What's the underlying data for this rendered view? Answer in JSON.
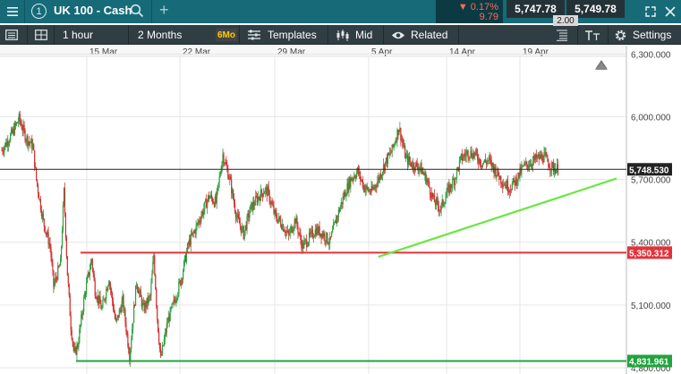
{
  "header": {
    "menu_icon": "hamburger-icon",
    "info_icon_text": "1",
    "symbol": "UK 100 - Cash",
    "search_icon": "search-icon",
    "add_icon": "plus-icon",
    "change_pct": "▼ 0.17%",
    "change_abs": "9.79",
    "sell_price": "5,747.78",
    "buy_price": "5,749.78",
    "spread": "2.00",
    "window_icons": [
      "expand-icon",
      "close-icon"
    ]
  },
  "toolbar": {
    "interval": "1 hour",
    "range": "2 Months",
    "range_badge": "6Mo",
    "templates_label": "Templates",
    "price_type_label": "Mid",
    "related_label": "Related",
    "settings_label": "Settings"
  },
  "chart_data": {
    "type": "candlestick",
    "instrument": "UK 100 - Cash",
    "interval": "1 hour",
    "x_tick_labels": [
      "15 Mar",
      "22 Mar",
      "29 Mar",
      "5 Apr",
      "14 Apr",
      "19 Apr"
    ],
    "y_tick_labels": [
      "6,300.000",
      "6,000.000",
      "5,700.000",
      "5,400.000",
      "5,100.000",
      "4,800.000"
    ],
    "y_ticks": [
      6300,
      6000,
      5700,
      5400,
      5100,
      4800
    ],
    "ylim": [
      4770,
      6340
    ],
    "grid": true,
    "colors": {
      "up": "#2f9e3f",
      "down": "#d3302f",
      "grid": "#e6e6e6"
    },
    "price_path": [
      [
        0,
        5840
      ],
      [
        3,
        5920
      ],
      [
        5,
        5990
      ],
      [
        7,
        5900
      ],
      [
        9,
        5860
      ],
      [
        10,
        5700
      ],
      [
        12,
        5500
      ],
      [
        14,
        5380
      ],
      [
        15,
        5190
      ],
      [
        17,
        5300
      ],
      [
        18,
        5640
      ],
      [
        19,
        5250
      ],
      [
        20,
        5000
      ],
      [
        21,
        4860
      ],
      [
        22,
        4910
      ],
      [
        24,
        5150
      ],
      [
        26,
        5320
      ],
      [
        27,
        5170
      ],
      [
        29,
        5080
      ],
      [
        31,
        5230
      ],
      [
        33,
        5010
      ],
      [
        35,
        5120
      ],
      [
        37,
        4860
      ],
      [
        39,
        5210
      ],
      [
        41,
        5080
      ],
      [
        43,
        5140
      ],
      [
        44,
        5340
      ],
      [
        45,
        5040
      ],
      [
        46,
        4840
      ],
      [
        48,
        5020
      ],
      [
        50,
        5120
      ],
      [
        52,
        5230
      ],
      [
        54,
        5390
      ],
      [
        56,
        5460
      ],
      [
        58,
        5540
      ],
      [
        60,
        5620
      ],
      [
        62,
        5590
      ],
      [
        64,
        5820
      ],
      [
        66,
        5700
      ],
      [
        68,
        5520
      ],
      [
        70,
        5440
      ],
      [
        72,
        5560
      ],
      [
        74,
        5610
      ],
      [
        76,
        5650
      ],
      [
        77,
        5640
      ],
      [
        79,
        5530
      ],
      [
        81,
        5490
      ],
      [
        83,
        5430
      ],
      [
        85,
        5510
      ],
      [
        87,
        5380
      ],
      [
        89,
        5420
      ],
      [
        91,
        5460
      ],
      [
        93,
        5440
      ],
      [
        95,
        5400
      ],
      [
        97,
        5520
      ],
      [
        99,
        5620
      ],
      [
        101,
        5700
      ],
      [
        103,
        5740
      ],
      [
        105,
        5660
      ],
      [
        107,
        5640
      ],
      [
        109,
        5700
      ],
      [
        111,
        5780
      ],
      [
        113,
        5840
      ],
      [
        115,
        5950
      ],
      [
        117,
        5800
      ],
      [
        119,
        5770
      ],
      [
        121,
        5760
      ],
      [
        123,
        5700
      ],
      [
        125,
        5600
      ],
      [
        127,
        5560
      ],
      [
        129,
        5640
      ],
      [
        131,
        5700
      ],
      [
        133,
        5800
      ],
      [
        135,
        5830
      ],
      [
        137,
        5820
      ],
      [
        139,
        5780
      ],
      [
        141,
        5790
      ],
      [
        143,
        5740
      ],
      [
        145,
        5690
      ],
      [
        147,
        5660
      ],
      [
        149,
        5700
      ],
      [
        151,
        5760
      ],
      [
        153,
        5780
      ],
      [
        155,
        5800
      ],
      [
        157,
        5810
      ],
      [
        159,
        5760
      ],
      [
        161,
        5750
      ]
    ],
    "horizontal_lines": [
      {
        "value": 5748.53,
        "label": "5,748.530",
        "color": "#222222"
      },
      {
        "value": 5350.312,
        "label": "5,350.312",
        "color": "#e2333b"
      },
      {
        "value": 4831.961,
        "label": "4,831.961",
        "color": "#21a33c"
      }
    ],
    "trendline": {
      "from": [
        109,
        5330
      ],
      "to": [
        178,
        5705
      ],
      "color": "#6ae83f"
    }
  }
}
